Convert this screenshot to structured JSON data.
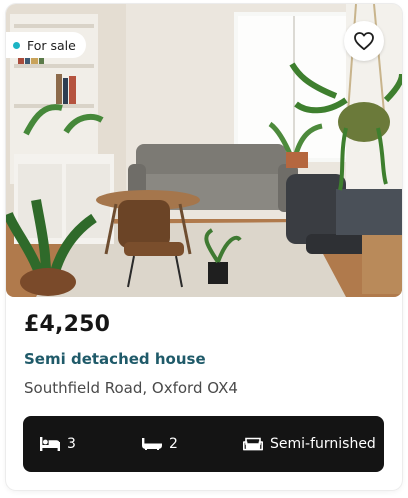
{
  "listing": {
    "status_badge": "For sale",
    "price": "£4,250",
    "property_type": "Semi detached house",
    "address": "Southfield Road, Oxford OX4"
  },
  "features": {
    "bedrooms": "3",
    "bathrooms": "2",
    "furnishing": "Semi-furnished"
  },
  "icons": {
    "favorite": "heart-icon",
    "bedrooms": "bed-icon",
    "bathrooms": "bath-icon",
    "furnishing": "sofa-icon"
  },
  "colors": {
    "badge_dot": "#1cb4c4",
    "property_type_text": "#1f5a69",
    "feature_bar_bg": "#141414"
  }
}
